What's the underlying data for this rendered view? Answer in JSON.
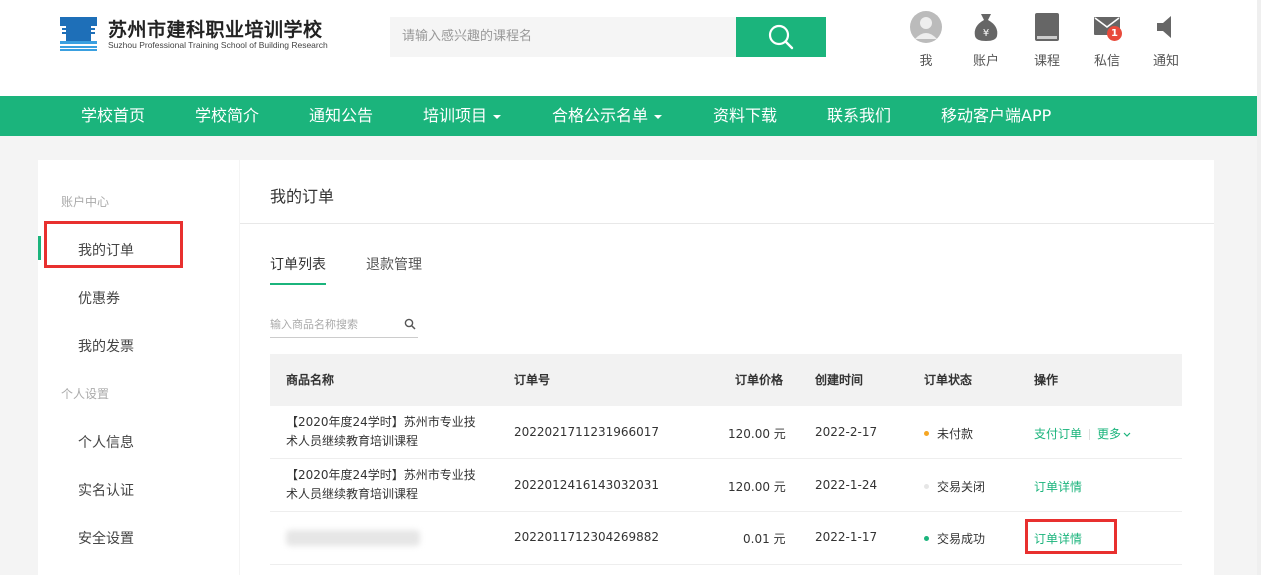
{
  "header": {
    "logo_title": "苏州市建科职业培训学校",
    "logo_subtitle": "Suzhou Professional Training School of Building Research",
    "search_placeholder": "请输入感兴趣的课程名",
    "nav_icons": [
      {
        "label": "我",
        "icon": "avatar-icon"
      },
      {
        "label": "账户",
        "icon": "money-bag-icon"
      },
      {
        "label": "课程",
        "icon": "book-icon"
      },
      {
        "label": "私信",
        "icon": "mail-icon",
        "badge": "1"
      },
      {
        "label": "通知",
        "icon": "speaker-icon"
      }
    ]
  },
  "mainnav": {
    "items": [
      "学校首页",
      "学校简介",
      "通知公告",
      "培训项目",
      "合格公示名单",
      "资料下载",
      "联系我们",
      "移动客户端APP"
    ]
  },
  "sidebar": {
    "group1": "账户中心",
    "items1": [
      "我的订单",
      "优惠券",
      "我的发票"
    ],
    "group2": "个人设置",
    "items2": [
      "个人信息",
      "实名认证",
      "安全设置"
    ]
  },
  "content": {
    "title": "我的订单",
    "tabs": [
      "订单列表",
      "退款管理"
    ],
    "search_placeholder": "输入商品名称搜索",
    "columns": [
      "商品名称",
      "订单号",
      "订单价格",
      "创建时间",
      "订单状态",
      "操作"
    ],
    "rows": [
      {
        "name": "【2020年度24学时】苏州市专业技术人员继续教育培训课程",
        "order_no": "2022021711231966017",
        "price": "120.00 元",
        "date": "2022-2-17",
        "status": "未付款",
        "status_color": "#f5a623",
        "action1": "支付订单",
        "action2": "更多"
      },
      {
        "name": "【2020年度24学时】苏州市专业技术人员继续教育培训课程",
        "order_no": "2022012416143032031",
        "price": "120.00 元",
        "date": "2022-1-24",
        "status": "交易关闭",
        "status_color": "#e6e6e6",
        "action1": "订单详情"
      },
      {
        "name": "",
        "order_no": "2022011712304269882",
        "price": "0.01 元",
        "date": "2022-1-17",
        "status": "交易成功",
        "status_color": "#1bb47c",
        "action1": "订单详情"
      }
    ]
  },
  "colors": {
    "accent": "#1bb47c",
    "highlight": "#e8302f"
  }
}
